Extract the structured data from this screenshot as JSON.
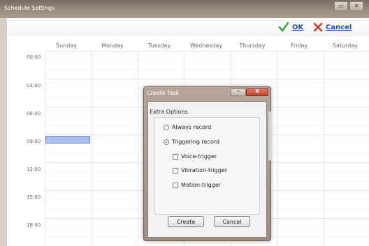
{
  "window": {
    "title": "Schedule Settings"
  },
  "toolbar": {
    "ok_label": "OK",
    "cancel_label": "Cancel"
  },
  "days": [
    "Sunday",
    "Monday",
    "Tuesday",
    "Wednesday",
    "Thursday",
    "Friday",
    "Saturday"
  ],
  "times": [
    "00:00",
    "03:00",
    "06:00",
    "09:00",
    "12:00",
    "15:00",
    "18:00"
  ],
  "dialog": {
    "title": "Create Task",
    "group_label": "Extra Options",
    "options": {
      "always_record": {
        "label": "Always record",
        "selected": false
      },
      "triggering_record": {
        "label": "Triggering record",
        "selected": true
      },
      "voice_trigger": {
        "label": "Voice-trigger",
        "checked": false
      },
      "vibration_trigger": {
        "label": "Vibration-trigger",
        "checked": false
      },
      "motion_trigger": {
        "label": "Motion-trigger",
        "checked": false
      }
    },
    "create_label": "Create",
    "cancel_label": "Cancel"
  },
  "icons": {
    "ok": "check-icon",
    "cancel": "x-icon",
    "close": "close-icon",
    "minimize": "minimize-icon"
  },
  "colors": {
    "accent_link": "#1a4fc4",
    "ok_green": "#3aa33a",
    "cancel_red": "#d23b2b",
    "selected_block": "#a9bff0"
  }
}
